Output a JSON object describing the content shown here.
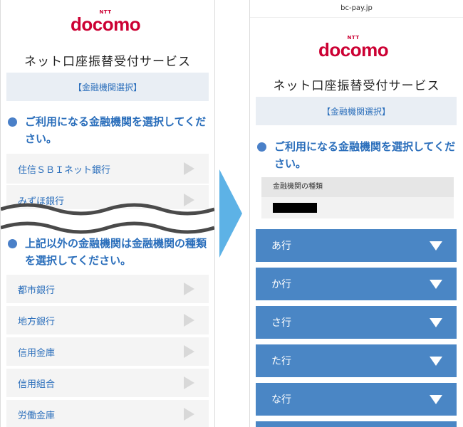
{
  "colors": {
    "brand_red": "#cc0033",
    "link_blue": "#2a6ebb",
    "row_blue": "#4a86c5",
    "bar_bg": "#e9eef4"
  },
  "left": {
    "logo": {
      "ntt": "NTT",
      "wordmark": "docomo"
    },
    "title": "ネット口座振替受付サービス",
    "bar": "【金融機関選択】",
    "heading1": "ご利用になる金融機関を選択してください。",
    "banks": [
      "住信ＳＢＩネット銀行",
      "みずほ銀行"
    ],
    "heading2": "上記以外の金融機関は金融機関の種類を選択してください。",
    "types": [
      "都市銀行",
      "地方銀行",
      "信用金庫",
      "信用組合",
      "労働金庫"
    ]
  },
  "right": {
    "url": "bc-pay.jp",
    "logo": {
      "ntt": "NTT",
      "wordmark": "docomo"
    },
    "title": "ネット口座振替受付サービス",
    "bar": "【金融機関選択】",
    "heading": "ご利用になる金融機関を選択してください。",
    "kind_label": "金融機関の種類",
    "rows": [
      "あ行",
      "か行",
      "さ行",
      "た行",
      "な行"
    ]
  }
}
